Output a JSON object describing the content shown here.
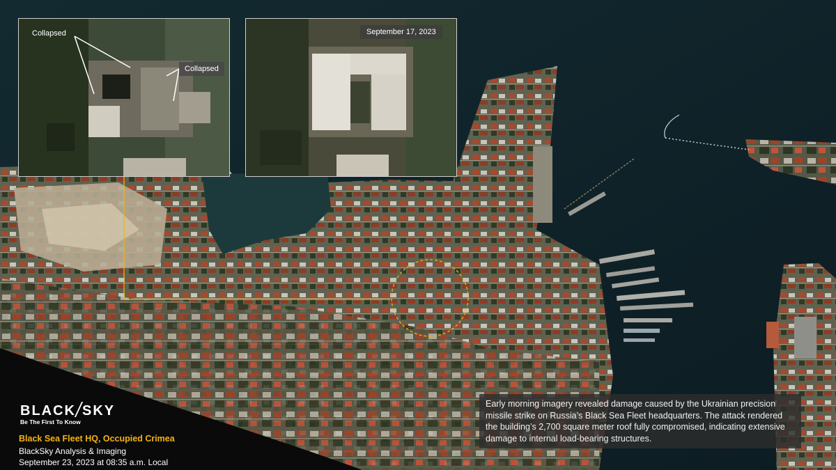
{
  "insets": {
    "before": {
      "label_collapsed_1": "Collapsed",
      "label_collapsed_2": "Collapsed"
    },
    "after": {
      "date": "September  17, 2023"
    }
  },
  "caption": "Early morning imagery revealed damage caused by the Ukrainian precision missile strike on Russia’s Black Sea Fleet headquarters. The attack rendered the building’s 2,700 square meter roof fully compromised, indicating extensive damage to internal load-bearing structures.",
  "branding": {
    "logo_left": "BLACK",
    "logo_right": "SKY",
    "tagline": "Be The First To Know"
  },
  "footer": {
    "location_title": "Black Sea Fleet HQ, Occupied Crimea",
    "credit": "BlackSky Analysis & Imaging",
    "timestamp": "September 23, 2023  at 08:35  a.m. Local"
  },
  "colors": {
    "accent_yellow": "#f2b311",
    "sea": "#0f2229",
    "land": "#6b6a55"
  }
}
